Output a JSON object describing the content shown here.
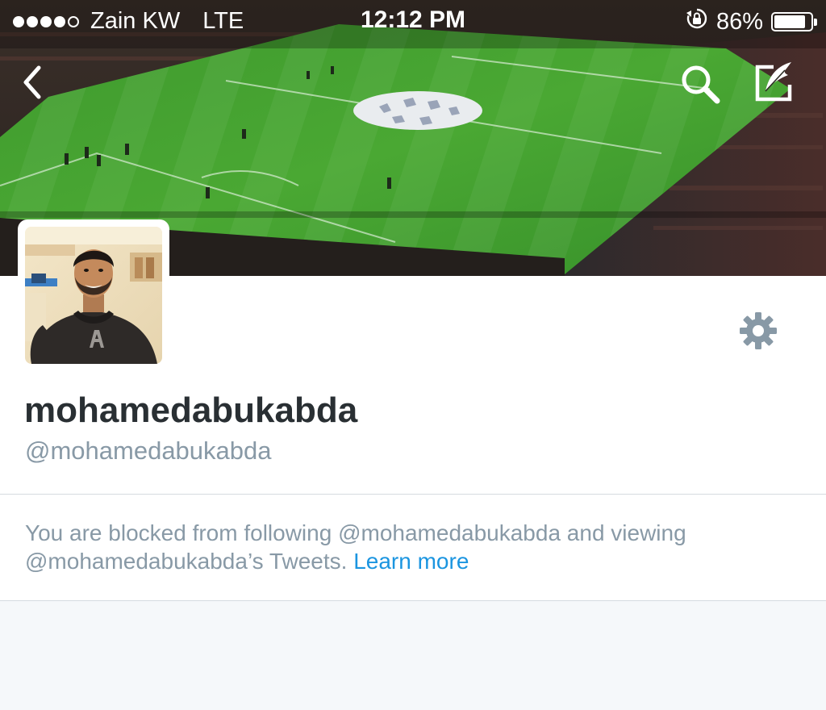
{
  "status_bar": {
    "carrier": "Zain KW",
    "network": "LTE",
    "time": "12:12 PM",
    "battery_percent": "86%",
    "battery_level": 0.86,
    "signal_bars_filled": 4,
    "signal_bars_total": 5,
    "lock_icon": "rotation-lock-icon"
  },
  "nav": {
    "back_icon": "back-chevron-icon",
    "search_icon": "search-icon",
    "compose_icon": "compose-tweet-icon"
  },
  "profile": {
    "display_name": "mohamedabukabda",
    "handle": "@mohamedabukabda",
    "settings_icon": "gear-icon"
  },
  "blocked_notice": {
    "message": "You are blocked from following @mohamedabukabda and viewing @mohamedabukabda’s Tweets. ",
    "link_label": "Learn more"
  },
  "colors": {
    "accent": "#1b95e0",
    "name_text": "#292f33",
    "muted_text": "#8899a6",
    "background": "#f5f8fa",
    "card": "#ffffff",
    "gear": "#8899a6"
  }
}
